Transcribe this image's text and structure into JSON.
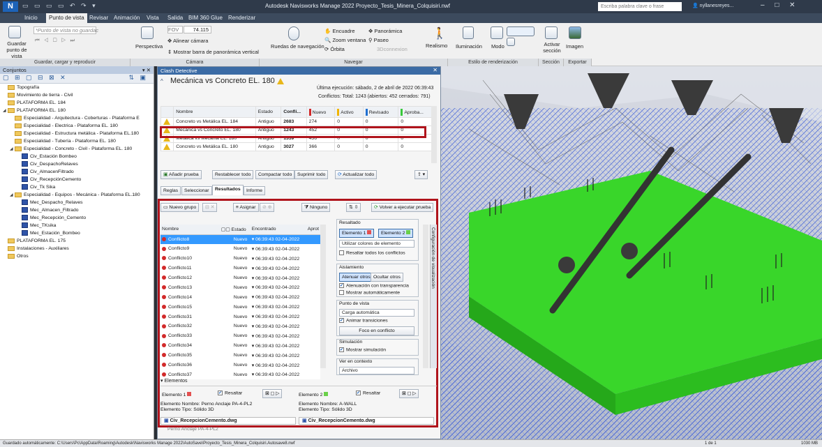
{
  "titlebar": {
    "logo": "N",
    "title": "Autodesk Navisworks Manage 2022   Proyecto_Tesis_Minera_Colquisiri.nwf",
    "search_placeholder": "Escriba palabra clave o frase",
    "user": "nyllanesreyes...",
    "window_controls": "– □ ✕"
  },
  "tabs": [
    "Inicio",
    "Punto de vista",
    "Revisar",
    "Animación",
    "Vista",
    "Salida",
    "BIM 360 Glue",
    "Renderizar"
  ],
  "active_tab": "Punto de vista",
  "ribbon": {
    "save_view": "Guardar punto de vista",
    "viewpoint_not_saved": "*Punto de vista no guardac",
    "perspective": "Perspectiva",
    "fov": "FOV",
    "fov_value": "74.115",
    "align_camera": "Alinear cámara",
    "panoramic_bar": "Mostrar barra de panorámica vertical",
    "nav_wheels": "Ruedas de navegación",
    "fit": "Encuadre",
    "zoom_window": "Zoom ventana",
    "orbit": "Órbita",
    "pan": "Panorámica",
    "walk": "Paseo",
    "connect": "3Dconnexion",
    "realism": "Realismo",
    "lighting": "Iluminación",
    "mode": "Modo",
    "activate_section": "Activar sección",
    "image": "Imagen",
    "groups": [
      "Guardar, cargar y reproducir",
      "Cámara",
      "Navegar",
      "Estilo de renderización",
      "Sección",
      "Exportar"
    ]
  },
  "sets_panel": {
    "title": "Conjuntos",
    "items": [
      {
        "label": "Topografía",
        "indent": 0,
        "type": "folder",
        "exp": ""
      },
      {
        "label": "Movimiento de tierra - Civil",
        "indent": 0,
        "type": "folder",
        "exp": ""
      },
      {
        "label": "PLATAFORMA EL. 184",
        "indent": 0,
        "type": "folder",
        "exp": ""
      },
      {
        "label": "PLATAFORMA EL. 180",
        "indent": 0,
        "type": "folder",
        "exp": "◢"
      },
      {
        "label": "Especialidad - Arquitectura - Coberturas - Plataforma E",
        "indent": 1,
        "type": "folder",
        "exp": ""
      },
      {
        "label": "Especialidad - Electrica - Plataforma EL. 180",
        "indent": 1,
        "type": "folder",
        "exp": ""
      },
      {
        "label": "Especialidad - Estructura metálica - Plataforma EL.180",
        "indent": 1,
        "type": "folder",
        "exp": ""
      },
      {
        "label": "Especialidad - Tubería - Plataforma EL. 180",
        "indent": 1,
        "type": "folder",
        "exp": ""
      },
      {
        "label": "Especialidad - Concreto - Civil - Plataforma EL. 180",
        "indent": 1,
        "type": "folder",
        "exp": "◢"
      },
      {
        "label": "Civ_Estación Bombeo",
        "indent": 2,
        "type": "sheet",
        "exp": ""
      },
      {
        "label": "Civ_DespachoRelaves",
        "indent": 2,
        "type": "sheet",
        "exp": ""
      },
      {
        "label": "Civ_AlmacenFiltrado",
        "indent": 2,
        "type": "sheet",
        "exp": ""
      },
      {
        "label": "Civ_RecepciónCemento",
        "indent": 2,
        "type": "sheet",
        "exp": ""
      },
      {
        "label": "Civ_Tk Sika",
        "indent": 2,
        "type": "sheet",
        "exp": ""
      },
      {
        "label": "Especialidad - Equipos - Mecánica - Plataforma EL.180",
        "indent": 1,
        "type": "folder",
        "exp": "◢"
      },
      {
        "label": "Mec_Despacho_Relaves",
        "indent": 2,
        "type": "sheet",
        "exp": ""
      },
      {
        "label": "Mec_Almacen_Filtrado",
        "indent": 2,
        "type": "sheet",
        "exp": ""
      },
      {
        "label": "Mec_Recepción_Cemento",
        "indent": 2,
        "type": "sheet",
        "exp": ""
      },
      {
        "label": "Mec_TKsika",
        "indent": 2,
        "type": "sheet",
        "exp": ""
      },
      {
        "label": "Mec_Estación_Bombeo",
        "indent": 2,
        "type": "sheet",
        "exp": ""
      },
      {
        "label": "PLATAFORMA EL. 175",
        "indent": 0,
        "type": "folder",
        "exp": ""
      },
      {
        "label": "Instalaciones - Auxiliares",
        "indent": 0,
        "type": "folder",
        "exp": ""
      },
      {
        "label": "Otros",
        "indent": 0,
        "type": "folder",
        "exp": ""
      }
    ]
  },
  "clash": {
    "window_title": "Clash Detective",
    "test_name": "Mecánica vs Concreto EL. 180",
    "last_run": "Última ejecución:  sábado, 2 de abril de 2022 06:39:43",
    "summary": "Conflictos: Total: 1243  (abiertos: 452  cerrados: 791)",
    "test_headers": [
      "Nombre",
      "Estado",
      "Confli...",
      "Nuevo",
      "Activo",
      "Revisado",
      "Aproba..."
    ],
    "tests": [
      {
        "name": "Concreto vs Metálica EL. 184",
        "estado": "Antiguo",
        "conf": "2683",
        "nuevo": "274",
        "activo": "0",
        "revisado": "0",
        "aprob": "0"
      },
      {
        "name": "Mecánica vs Concreto EL. 180",
        "estado": "Antiguo",
        "conf": "1243",
        "nuevo": "452",
        "activo": "0",
        "revisado": "0",
        "aprob": "0"
      },
      {
        "name": "Metálica vs Mecánia EL. 180",
        "estado": "Antiguo",
        "conf": "1359",
        "nuevo": "456",
        "activo": "0",
        "revisado": "0",
        "aprob": "0"
      },
      {
        "name": "Concreto vs Metálica EL. 180",
        "estado": "Antiguo",
        "conf": "3027",
        "nuevo": "366",
        "activo": "0",
        "revisado": "0",
        "aprob": "0"
      }
    ],
    "buttons": {
      "add_test": "Añadir prueba",
      "reset_all": "Restablecer todo",
      "compact_all": "Compactar todo",
      "delete_all": "Suprimir todo",
      "update_all": "Actualizar todo"
    },
    "subtabs": [
      "Reglas",
      "Seleccionar",
      "Resultados",
      "Informe"
    ],
    "active_subtab": "Resultados",
    "results_toolbar": {
      "new_group": "Nuevo grupo",
      "assign": "Asignar",
      "none": "Ninguno",
      "rerun": "Volver a ejecutar prueba"
    },
    "result_headers": [
      "Nombre",
      "Estado",
      "Encontrado",
      "Aprot"
    ],
    "results": [
      {
        "name": "Conflicto8",
        "estado": "Nuevo",
        "found": "06:39:43 02-04-2022"
      },
      {
        "name": "Conflicto9",
        "estado": "Nuevo",
        "found": "06:39:43 02-04-2022"
      },
      {
        "name": "Conflicto10",
        "estado": "Nuevo",
        "found": "06:39:43 02-04-2022"
      },
      {
        "name": "Conflicto11",
        "estado": "Nuevo",
        "found": "06:39:43 02-04-2022"
      },
      {
        "name": "Conflicto12",
        "estado": "Nuevo",
        "found": "06:39:43 02-04-2022"
      },
      {
        "name": "Conflicto13",
        "estado": "Nuevo",
        "found": "06:39:43 02-04-2022"
      },
      {
        "name": "Conflicto14",
        "estado": "Nuevo",
        "found": "06:39:43 02-04-2022"
      },
      {
        "name": "Conflicto15",
        "estado": "Nuevo",
        "found": "06:39:43 02-04-2022"
      },
      {
        "name": "Conflicto31",
        "estado": "Nuevo",
        "found": "06:39:43 02-04-2022"
      },
      {
        "name": "Conflicto32",
        "estado": "Nuevo",
        "found": "06:39:43 02-04-2022"
      },
      {
        "name": "Conflicto33",
        "estado": "Nuevo",
        "found": "06:39:43 02-04-2022"
      },
      {
        "name": "Conflicto34",
        "estado": "Nuevo",
        "found": "06:39:43 02-04-2022"
      },
      {
        "name": "Conflicto35",
        "estado": "Nuevo",
        "found": "06:39:43 02-04-2022"
      },
      {
        "name": "Conflicto36",
        "estado": "Nuevo",
        "found": "06:39:43 02-04-2022"
      },
      {
        "name": "Conflicto37",
        "estado": "Nuevo",
        "found": "06:39:43 02-04-2022"
      }
    ],
    "highlight": {
      "title": "Resaltado",
      "elem1": "Elemento 1",
      "elem2": "Elemento 2",
      "use_colors": "Utilizar colores de elemento",
      "highlight_all": "Resaltar todos los conflictos"
    },
    "isolation": {
      "title": "Aislamiento",
      "dim_others": "Atenuar otros",
      "hide_others": "Ocultar otros",
      "transparency": "Atenuación con transparencia",
      "auto_show": "Mostrar automáticamente"
    },
    "viewpoint": {
      "title": "Punto de vista",
      "auto_load": "Carga automática",
      "animate": "Animar transiciones",
      "focus": "Foco en conflicto"
    },
    "simulation": {
      "title": "Simulación",
      "show": "Mostrar simulación"
    },
    "context": {
      "title": "Ver en contexto",
      "value": "Archivo"
    },
    "side_tab": "Configuración de visualización",
    "elements": {
      "header": "Elementos",
      "e1": "Elemento 1",
      "e2": "Elemento 2",
      "highlight": "Resaltar",
      "e1_name": "Elemento Nombre: Perno Anclaje PA-4-PL2",
      "e1_type": "Elemento Tipo: Sólido 3D",
      "e2_name": "Elemento Nombre: A-WALL",
      "e2_type": "Elemento Tipo: Sólido 3D",
      "e1_file": "Civ_RecepcionCemento.dwg",
      "e2_file": "Civ_RecepcionCemento.dwg",
      "e1_sub": "Perno Anclaje PA-4-PL2"
    }
  },
  "statusbar": {
    "autosave": "Guardado automáticamente: C:\\Users\\Pc\\AppData\\Roaming\\Autodesk\\Navisworks Manage 2022\\AutoSave\\Proyecto_Tesis_Minera_Colquisiri.Autosave8.nwf",
    "page": "1 de 1",
    "memory": "1030 MB"
  },
  "colors": {
    "accent": "#3b6ba5",
    "selection": "#3399ff",
    "red_frame": "#b0141c",
    "platform_green": "#3fd22a",
    "new_bar": "#d22a2a",
    "active_bar": "#f0b400",
    "reviewed_bar": "#1f6fd1",
    "approved_bar": "#38c93a"
  }
}
